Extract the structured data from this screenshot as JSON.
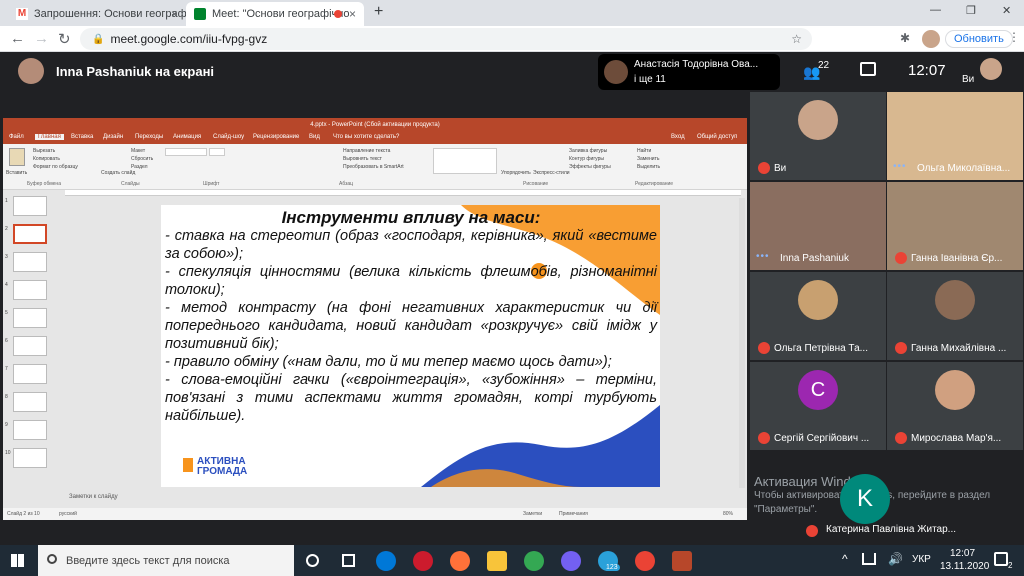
{
  "browser": {
    "tabs": [
      {
        "title": "Запрошення: Основи географічн",
        "close": "×"
      },
      {
        "title": "Meet: \"Основи географічно",
        "close": "×"
      }
    ],
    "new_tab": "+",
    "url": "meet.google.com/iiu-fvpg-gvz",
    "update_button": "Обновить",
    "window_controls": {
      "min": "—",
      "max": "❐",
      "close": "✕"
    }
  },
  "meet": {
    "presenter_label": "Inna Pashaniuk на екрані",
    "active_speaker": "Анастасія Тодорівна Ова...",
    "active_speaker_more": "і ще 11",
    "participant_count": "22",
    "time": "12:07",
    "self_label": "Ви"
  },
  "ppt": {
    "window_title": "4.pptx - PowerPoint (Сбой активации продукта)",
    "menu": [
      "Файл",
      "Главная",
      "Вставка",
      "Дизайн",
      "Переходы",
      "Анимация",
      "Слайд-шоу",
      "Рецензирование",
      "Вид",
      "Что вы хотите сделать?"
    ],
    "menu_right": [
      "Вход",
      "Общий доступ"
    ],
    "ribbon_groups": [
      "Буфер обмена",
      "Слайды",
      "Шрифт",
      "Абзац",
      "Рисование",
      "Редактирование"
    ],
    "ribbon_items": [
      "Вставить",
      "Вырезать",
      "Копировать",
      "Формат по образцу",
      "Создать слайд",
      "Макет",
      "Сбросить",
      "Раздел",
      "Направление текста",
      "Выровнять текст",
      "Преобразовать в SmartArt",
      "Упорядочить",
      "Экспресс-стили",
      "Заливка фигуры",
      "Контур фигуры",
      "Эффекты фигуры",
      "Найти",
      "Заменить",
      "Выделить"
    ],
    "thumb_numbers": [
      "1",
      "2",
      "3",
      "4",
      "5",
      "6",
      "7",
      "8",
      "9",
      "10"
    ],
    "notes_placeholder": "Заметки к слайду",
    "status_left": "Слайд 2 из 10",
    "status_lang": "русский",
    "status_right": [
      "Заметки",
      "Примечания",
      "80%"
    ]
  },
  "slide": {
    "title": "Інструменти впливу на маси:",
    "bullets": [
      "- ставка на стереотип (образ «господаря, керівника», який «вестиме за собою»);",
      "- спекуляція цінностями (велика кількість флешмобів, різноманітні толоки);",
      "- метод контрасту (на фоні негативних характеристик чи дії попереднього кандидата, новий кандидат «розкручує» свій імідж у позитивний бік);",
      "- правило обміну («нам дали, то й ми тепер маємо щось дати»);",
      "- слова-емоційні гачки («євроінтеграція», «зубожіння» – терміни, пов'язані з тими аспектами життя громадян, котрі турбують найбільше)."
    ],
    "logo_line1": "АКТИВНА",
    "logo_line2": "ГРОМАДА"
  },
  "participants": [
    {
      "name": "Ви",
      "avatar_color": "#c9a48a",
      "muted": true
    },
    {
      "name": "Ольга Миколаївна...",
      "avatar_color": "#d8b890",
      "muted": false
    },
    {
      "name": "Inna Pashaniuk",
      "avatar_color": "#b48c78",
      "muted": false
    },
    {
      "name": "Ганна Іванівна Єр...",
      "avatar_color": "#a08870",
      "muted": true
    },
    {
      "name": "Ольга Петрівна Та...",
      "avatar_color": "#c8a070",
      "muted": true
    },
    {
      "name": "Ганна Михайлівна ...",
      "avatar_color": "#8a6a55",
      "muted": true
    },
    {
      "name": "Сергій Сергійович ...",
      "avatar_color": "#9c27b0",
      "letter": "С",
      "muted": true
    },
    {
      "name": "Мирослава Мар'я...",
      "avatar_color": "#d0a080",
      "muted": true
    }
  ],
  "last_participant": {
    "name": "Катерина Павлівна Житар...",
    "letter": "K",
    "avatar_color": "#00897b"
  },
  "activation": {
    "title": "Активация Windows",
    "text": "Чтобы активировать Windows, перейдите в раздел \"Параметры\"."
  },
  "taskbar": {
    "search_placeholder": "Введите здесь текст для поиска",
    "lang": "УКР",
    "time": "12:07",
    "date": "13.11.2020",
    "notif_count": "2",
    "badge": "123"
  },
  "colors": {
    "accent_blue": "#1a73e8",
    "ppt_red": "#b7472a",
    "muted_red": "#ea4335",
    "slide_orange": "#f7941d",
    "slide_blue": "#2b4fbf"
  }
}
